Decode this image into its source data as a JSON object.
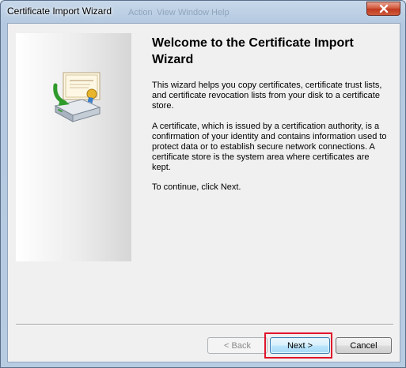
{
  "window": {
    "title": "Certificate Import Wizard",
    "ghost_menu": [
      "Action",
      "View",
      "Window",
      "Help"
    ]
  },
  "content": {
    "heading": "Welcome to the Certificate Import Wizard",
    "paragraphs": [
      "This wizard helps you copy certificates, certificate trust lists, and certificate revocation lists from your disk to a certificate store.",
      "A certificate, which is issued by a certification authority, is a confirmation of your identity and contains information used to protect data or to establish secure network connections. A certificate store is the system area where certificates are kept.",
      "To continue, click Next."
    ]
  },
  "buttons": {
    "back": "< Back",
    "next": "Next >",
    "cancel": "Cancel"
  },
  "icons": {
    "close": "close-icon",
    "wizard": "certificate-import-icon"
  },
  "colors": {
    "highlight": "#e0142c",
    "close_button": "#c0391f",
    "title_bar": "#b4c9e0"
  }
}
